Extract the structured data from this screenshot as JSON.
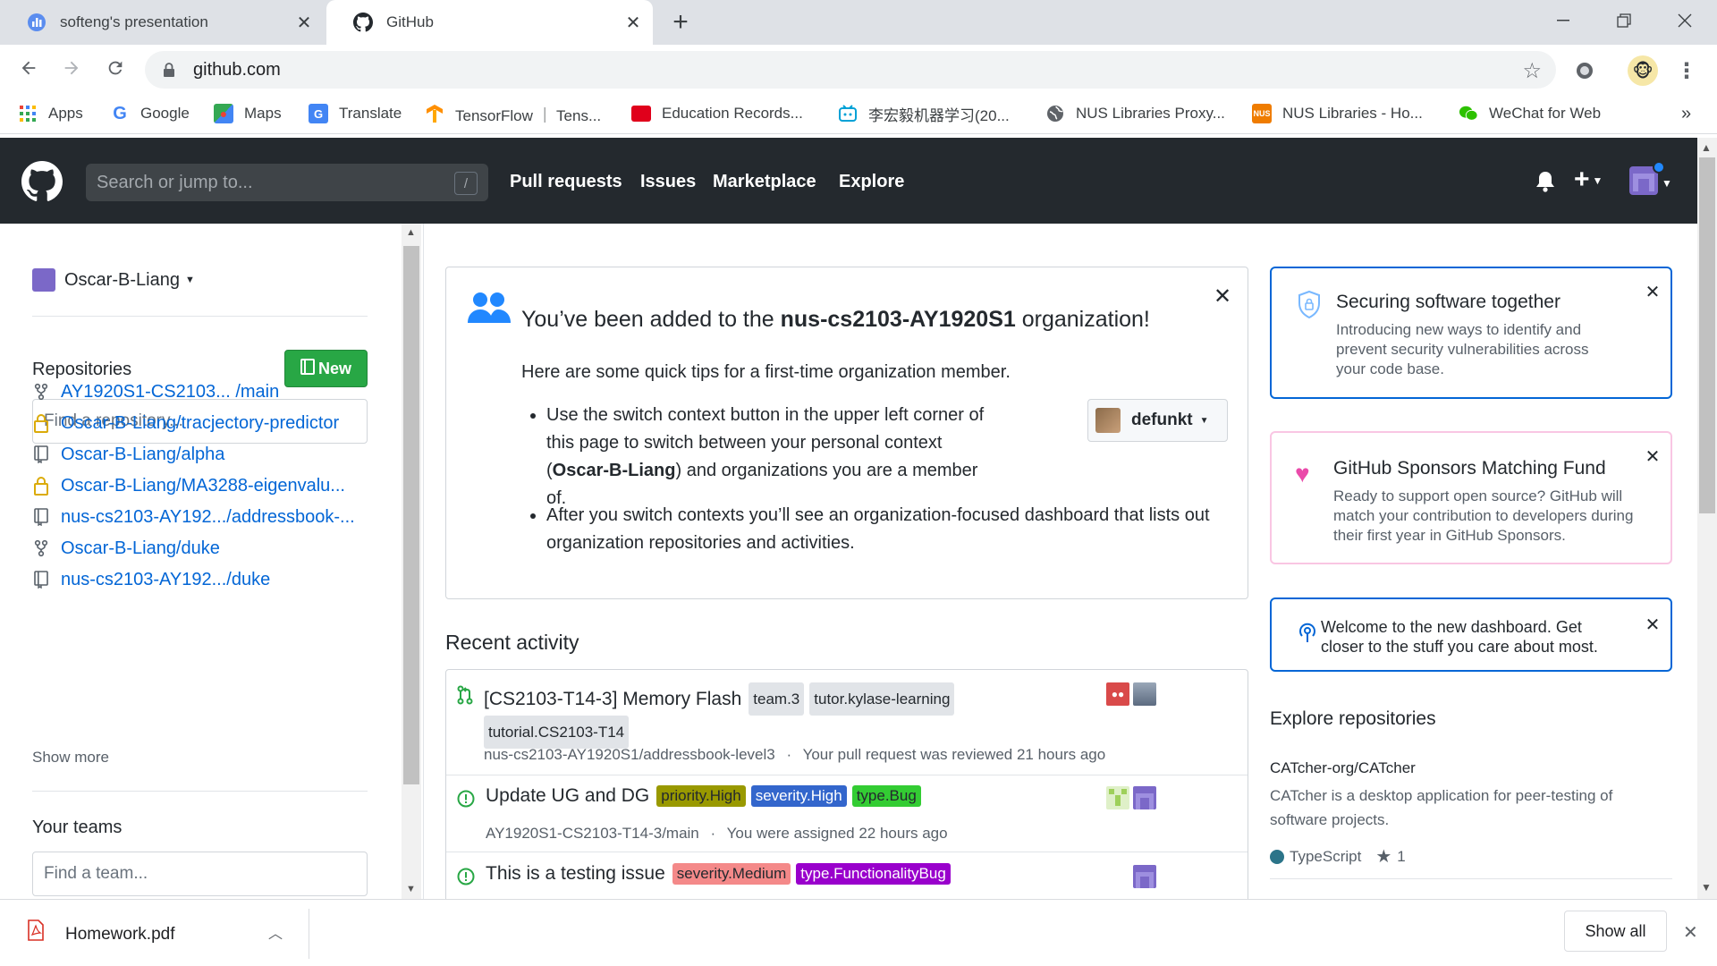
{
  "browser": {
    "tabs": [
      {
        "title": "softeng's presentation",
        "active": false
      },
      {
        "title": "GitHub",
        "active": true
      }
    ],
    "url": "github.com",
    "bookmarks": [
      {
        "label": "Apps",
        "icon": "apps-grid-icon"
      },
      {
        "label": "Google",
        "icon": "google-icon"
      },
      {
        "label": "Maps",
        "icon": "maps-icon"
      },
      {
        "label": "Translate",
        "icon": "translate-icon"
      },
      {
        "label": "TensorFlow ｜ Tens...",
        "icon": "tensorflow-icon"
      },
      {
        "label": "Education Records...",
        "icon": "oracle-icon"
      },
      {
        "label": "李宏毅机器学习(20...",
        "icon": "bilibili-icon"
      },
      {
        "label": "NUS Libraries Proxy...",
        "icon": "globe-icon"
      },
      {
        "label": "NUS Libraries - Ho...",
        "icon": "nus-icon"
      },
      {
        "label": "WeChat for Web",
        "icon": "wechat-icon"
      }
    ],
    "more_bookmarks": "»"
  },
  "github": {
    "search_placeholder": "Search or jump to...",
    "search_shortcut": "/",
    "nav": [
      "Pull requests",
      "Issues",
      "Marketplace",
      "Explore"
    ],
    "plus": "+"
  },
  "sidebar": {
    "context_user": "Oscar-B-Liang",
    "repositories_title": "Repositories",
    "new_button": "New",
    "repo_search_placeholder": "Find a repository...",
    "repos": [
      {
        "name": "AY1920S1-CS2103... /main",
        "icon": "fork-icon"
      },
      {
        "name": "Oscar-B-Liang/tracjectory-predictor",
        "icon": "lock-icon"
      },
      {
        "name": "Oscar-B-Liang/alpha",
        "icon": "repo-icon"
      },
      {
        "name": "Oscar-B-Liang/MA3288-eigenvalu...",
        "icon": "lock-icon"
      },
      {
        "name": "nus-cs2103-AY192.../addressbook-...",
        "icon": "repo-icon"
      },
      {
        "name": "Oscar-B-Liang/duke",
        "icon": "fork-icon"
      },
      {
        "name": "nus-cs2103-AY192.../duke",
        "icon": "repo-icon"
      }
    ],
    "show_more": "Show more",
    "teams_title": "Your teams",
    "team_search_placeholder": "Find a team..."
  },
  "org_notice": {
    "title_prefix": "You’ve been added to the ",
    "org_name": "nus-cs2103-AY1920S1",
    "title_suffix": " organization!",
    "intro": "Here are some quick tips for a first-time organization member.",
    "tip1_part1": "Use the switch context button in the upper left corner of this page to switch between your personal context (",
    "tip1_bold": "Oscar-B-Liang",
    "tip1_part2": ") and organizations you are a member of.",
    "tip2": "After you switch contexts you’ll see an organization-focused dashboard that lists out organization repositories and activities.",
    "switcher_user": "defunkt"
  },
  "recent_activity": {
    "title": "Recent activity",
    "items": [
      {
        "title": "[CS2103-T14-3] Memory Flash",
        "labels": [
          {
            "text": "team.3",
            "bg": "#e1e4e8",
            "fg": "#24292e"
          },
          {
            "text": "tutor.kylase-learning",
            "bg": "#e1e4e8",
            "fg": "#24292e"
          },
          {
            "text": "tutorial.CS2103-T14",
            "bg": "#e1e4e8",
            "fg": "#24292e"
          }
        ],
        "repo": "nus-cs2103-AY1920S1/addressbook-level3",
        "sep": "·",
        "meta": "Your pull request was reviewed 21 hours ago",
        "icon": "pull-request-icon"
      },
      {
        "title": "Update UG and DG",
        "labels": [
          {
            "text": "priority.High",
            "bg": "#999900",
            "fg": "#24292e"
          },
          {
            "text": "severity.High",
            "bg": "#3366cc",
            "fg": "#ffffff"
          },
          {
            "text": "type.Bug",
            "bg": "#33cc33",
            "fg": "#24292e"
          }
        ],
        "repo": "AY1920S1-CS2103-T14-3/main",
        "sep": "·",
        "meta": "You were assigned 22 hours ago",
        "icon": "issue-open-icon"
      },
      {
        "title": "This is a testing issue",
        "labels": [
          {
            "text": "severity.Medium",
            "bg": "#f48989",
            "fg": "#24292e"
          },
          {
            "text": "type.FunctionalityBug",
            "bg": "#9900cc",
            "fg": "#ffffff"
          }
        ],
        "icon": "issue-open-icon"
      }
    ]
  },
  "right_cards": {
    "security": {
      "title": "Securing software together",
      "body": "Introducing new ways to identify and prevent security vulnerabilities across your code base."
    },
    "sponsors": {
      "title": "GitHub Sponsors Matching Fund",
      "body": "Ready to support open source? GitHub will match your contribution to developers during their first year in GitHub Sponsors."
    },
    "welcome": {
      "body": "Welcome to the new dashboard. Get closer to the stuff you care about most."
    },
    "explore": {
      "title": "Explore repositories",
      "repo_name": "CATcher-org/CATcher",
      "repo_desc": "CATcher is a desktop application for peer-testing of software projects.",
      "language": "TypeScript",
      "language_color": "#2b7489",
      "stars": "1"
    }
  },
  "download_bar": {
    "file": "Homework.pdf",
    "show_all": "Show all"
  },
  "colors": {
    "github_header": "#24292e",
    "link": "#0366d6",
    "new_button": "#28a745",
    "sponsor_pink": "#ea4aaa"
  }
}
